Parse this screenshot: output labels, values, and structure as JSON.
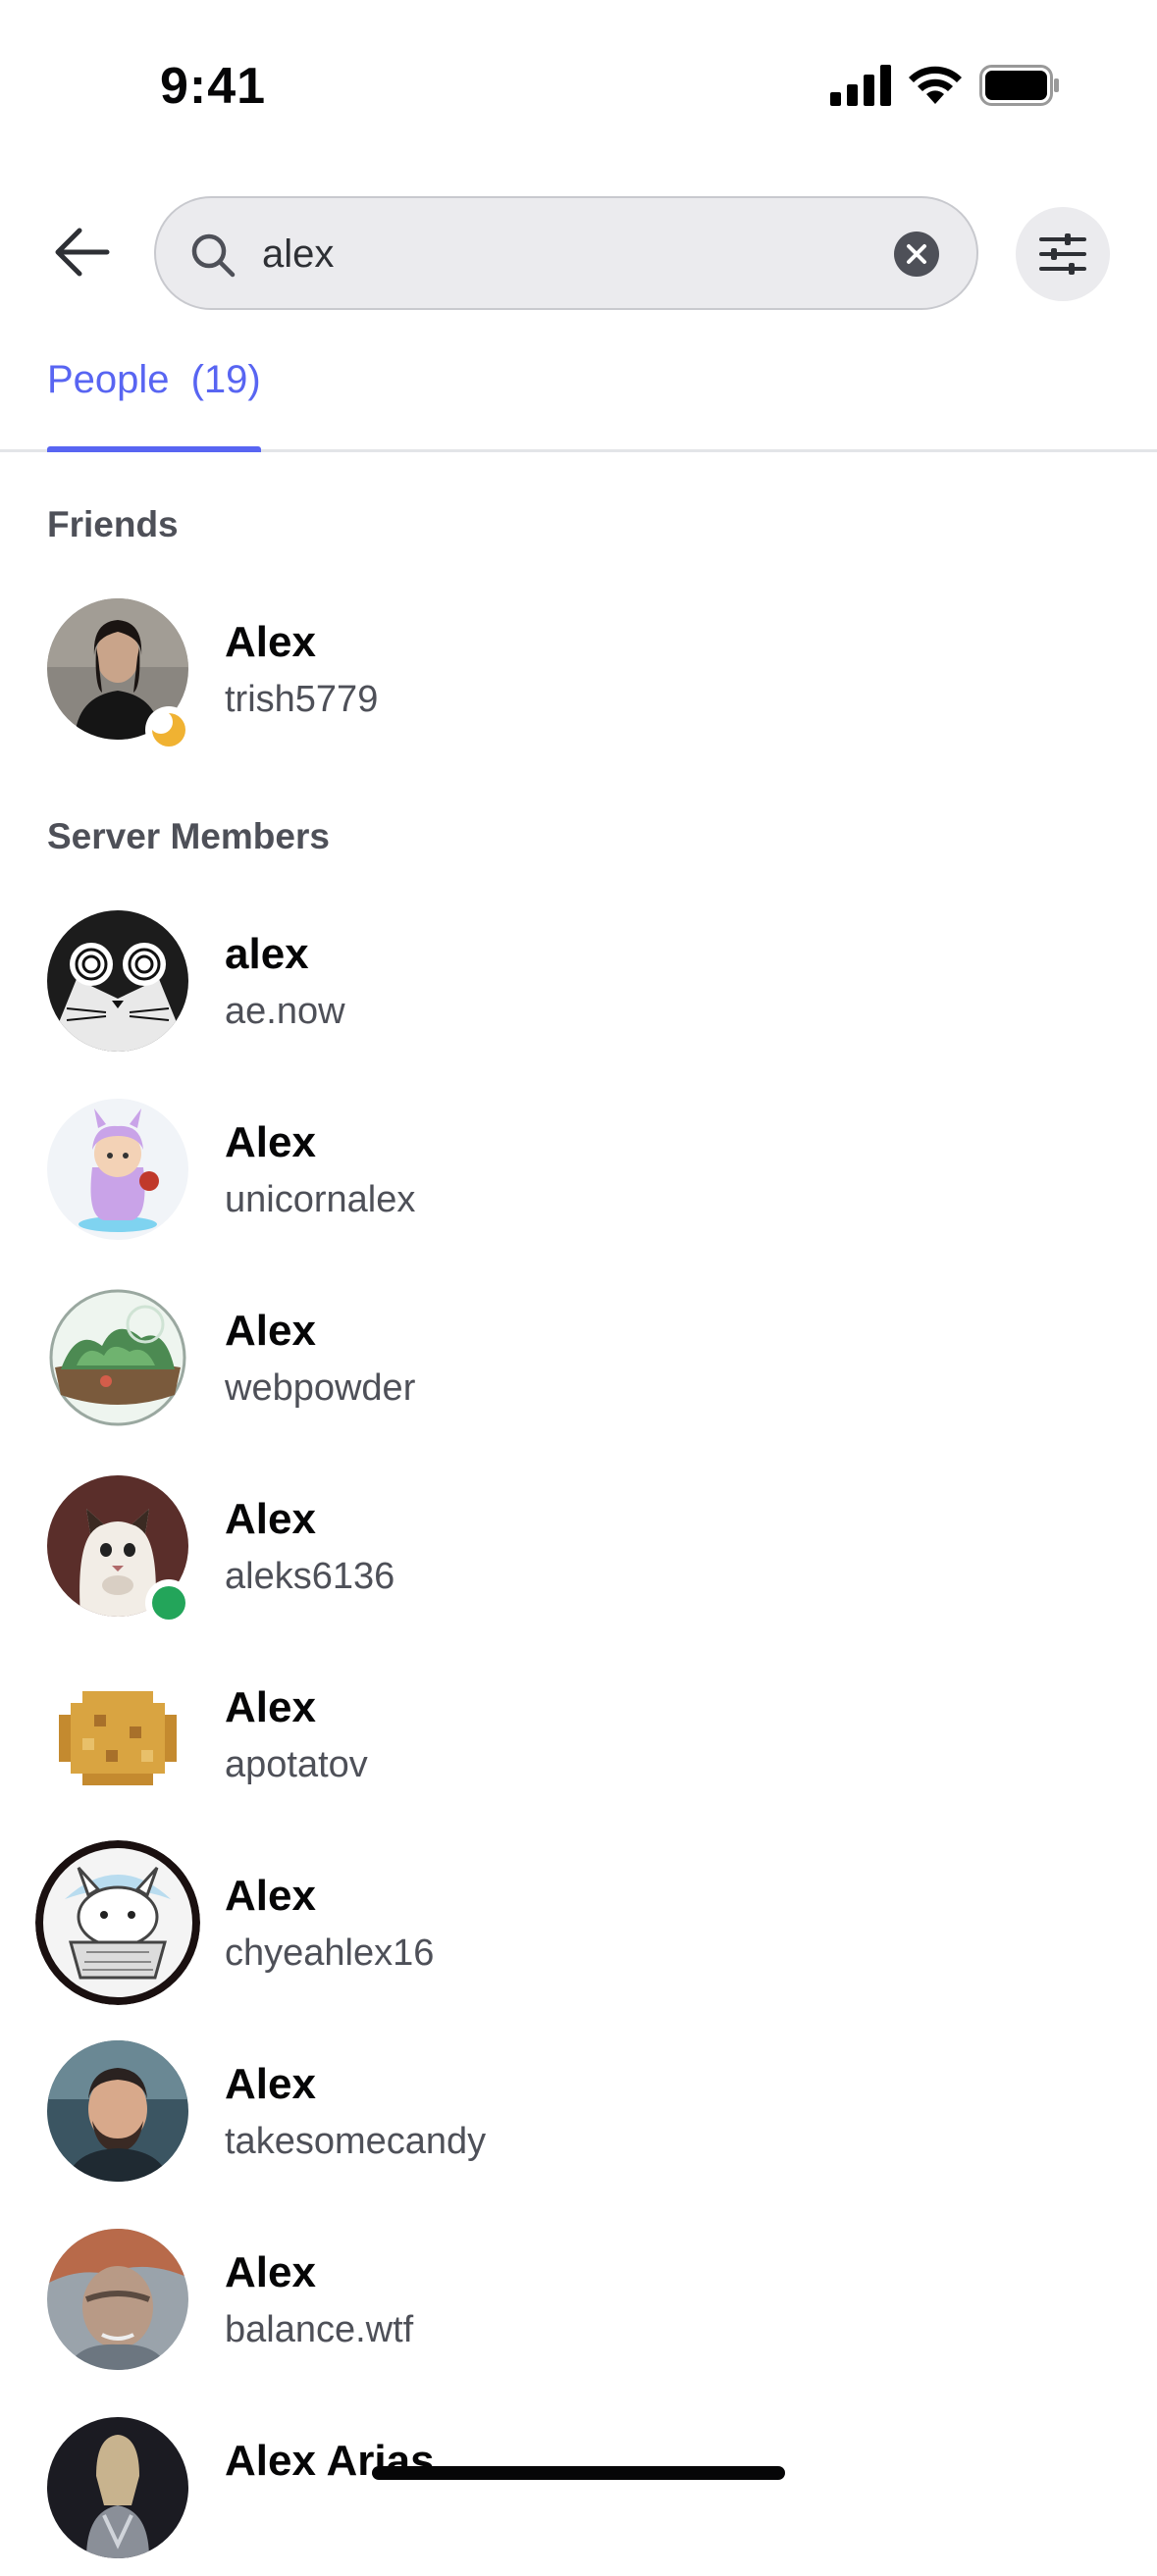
{
  "status_bar": {
    "time": "9:41"
  },
  "search": {
    "value": "alex"
  },
  "tabs": {
    "people_label": "People",
    "people_count": "(19)"
  },
  "sections": {
    "friends_label": "Friends",
    "server_members_label": "Server Members"
  },
  "friends": [
    {
      "name": "Alex",
      "username": "trish5779",
      "status": "idle",
      "avatar": "photo-woman-avatar"
    }
  ],
  "members": [
    {
      "name": "alex",
      "username": "ae.now",
      "avatar": "cat-bw-avatar"
    },
    {
      "name": "Alex",
      "username": "unicornalex",
      "avatar": "cartoon-unicorn-avatar"
    },
    {
      "name": "Alex",
      "username": "webpowder",
      "avatar": "terrarium-avatar"
    },
    {
      "name": "Alex",
      "username": "aleks6136",
      "status": "online",
      "avatar": "cat-photo-avatar"
    },
    {
      "name": "Alex",
      "username": "apotatov",
      "avatar": "pixel-potato-avatar"
    },
    {
      "name": "Alex",
      "username": "chyeahlex16",
      "avatar": "bunny-computer-avatar"
    },
    {
      "name": "Alex",
      "username": "takesomecandy",
      "avatar": "photo-man-avatar"
    },
    {
      "name": "Alex",
      "username": "balance.wtf",
      "avatar": "painted-face-avatar"
    },
    {
      "name": "Alex Arias",
      "username": "",
      "avatar": "armored-figure-avatar"
    }
  ],
  "colors": {
    "accent": "#5865f2",
    "idle": "#f0b232",
    "online": "#23a55a"
  }
}
